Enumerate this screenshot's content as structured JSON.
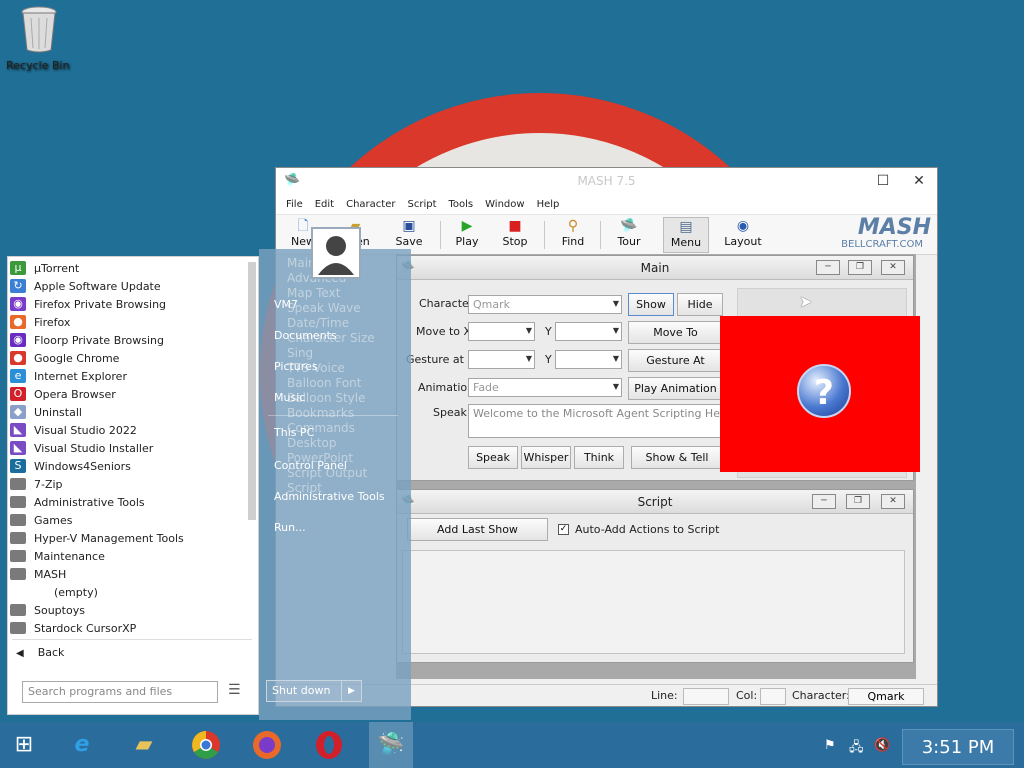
{
  "desktop": {
    "recycle_bin": "Recycle Bin"
  },
  "mash": {
    "title": "MASH 7.5",
    "menu": [
      "File",
      "Edit",
      "Character",
      "Script",
      "Tools",
      "Window",
      "Help"
    ],
    "toolbar": {
      "new": "New",
      "open": "Open",
      "save": "Save",
      "play": "Play",
      "stop": "Stop",
      "find": "Find",
      "tour": "Tour",
      "menu": "Menu",
      "layout": "Layout"
    },
    "logo": {
      "name": "MASH",
      "site": "BELLCRAFT.COM"
    },
    "main": {
      "title": "Main",
      "character_label": "Character",
      "character_value": "Qmark",
      "show": "Show",
      "hide": "Hide",
      "move_to_x_label": "Move to X",
      "y_label": "Y",
      "move_to": "Move To",
      "gesture_at_x_label": "Gesture at X",
      "gesture_at": "Gesture At",
      "animation_label": "Animation",
      "animation_value": "Fade",
      "play_animation": "Play Animation",
      "speak_label": "Speak",
      "speak_value": "Welcome to the Microsoft Agent Scripting Helper!",
      "speak_btn": "Speak",
      "whisper_btn": "Whisper",
      "think_btn": "Think",
      "show_tell_btn": "Show & Tell"
    },
    "script": {
      "title": "Script",
      "add_last_show": "Add Last Show",
      "auto_add": "Auto-Add Actions to Script"
    },
    "status": {
      "line": "Line:",
      "col": "Col:",
      "character": "Character:",
      "character_value": "Qmark"
    }
  },
  "startmenu": {
    "programs": [
      {
        "label": "µTorrent",
        "icon": "utorrent-icon",
        "color": "#3c9a3c",
        "glyph": "µ"
      },
      {
        "label": "Apple Software Update",
        "icon": "apple-update-icon",
        "color": "#3a7fd4",
        "glyph": "↻"
      },
      {
        "label": "Firefox Private Browsing",
        "icon": "firefox-private-icon",
        "color": "#7a3cc8",
        "glyph": "◉"
      },
      {
        "label": "Firefox",
        "icon": "firefox-icon",
        "color": "#e8692a",
        "glyph": "●"
      },
      {
        "label": "Floorp Private Browsing",
        "icon": "floorp-private-icon",
        "color": "#6a2cc0",
        "glyph": "◉"
      },
      {
        "label": "Google Chrome",
        "icon": "chrome-icon",
        "color": "#d9382a",
        "glyph": "●"
      },
      {
        "label": "Internet Explorer",
        "icon": "ie-icon",
        "color": "#2a8fd6",
        "glyph": "e"
      },
      {
        "label": "Opera Browser",
        "icon": "opera-icon",
        "color": "#d21f2a",
        "glyph": "O"
      },
      {
        "label": "Uninstall",
        "icon": "uninstall-icon",
        "color": "#8aa0c8",
        "glyph": "◆"
      },
      {
        "label": "Visual Studio 2022",
        "icon": "vs2022-icon",
        "color": "#7a4bc2",
        "glyph": "◣"
      },
      {
        "label": "Visual Studio Installer",
        "icon": "vs-installer-icon",
        "color": "#7a4bc2",
        "glyph": "◣"
      },
      {
        "label": "Windows4Seniors",
        "icon": "windows4seniors-icon",
        "color": "#1b6d9e",
        "glyph": "S"
      },
      {
        "label": "7-Zip",
        "icon": "folder-icon",
        "color": "#7a7a7a",
        "glyph": ""
      },
      {
        "label": "Administrative Tools",
        "icon": "folder-icon",
        "color": "#7a7a7a",
        "glyph": ""
      },
      {
        "label": "Games",
        "icon": "folder-icon",
        "color": "#7a7a7a",
        "glyph": ""
      },
      {
        "label": "Hyper-V Management Tools",
        "icon": "folder-icon",
        "color": "#7a7a7a",
        "glyph": ""
      },
      {
        "label": "Maintenance",
        "icon": "folder-icon",
        "color": "#7a7a7a",
        "glyph": ""
      },
      {
        "label": "MASH",
        "icon": "folder-icon",
        "color": "#7a7a7a",
        "glyph": ""
      },
      {
        "label": "(empty)",
        "icon": "",
        "color": "",
        "glyph": ""
      },
      {
        "label": "Souptoys",
        "icon": "folder-icon",
        "color": "#7a7a7a",
        "glyph": ""
      },
      {
        "label": "Stardock CursorXP",
        "icon": "folder-icon",
        "color": "#7a7a7a",
        "glyph": ""
      }
    ],
    "back": "Back",
    "search_placeholder": "Search programs and files",
    "right": [
      "VM7",
      "Documents",
      "Pictures",
      "Music",
      "This PC",
      "Control Panel",
      "Administrative Tools",
      "Run..."
    ],
    "shutdown": "Shut down",
    "behind_menu": [
      "Main",
      "Advanced",
      "Map Text",
      "Speak Wave",
      "Date/Time",
      "Character Size",
      "Sing",
      "TTS Voice",
      "Balloon Font",
      "Balloon Style",
      "Bookmarks",
      "Commands",
      "Desktop",
      "PowerPoint",
      "Script Output",
      "Script"
    ]
  },
  "taskbar": {
    "time": "3:51 PM"
  }
}
